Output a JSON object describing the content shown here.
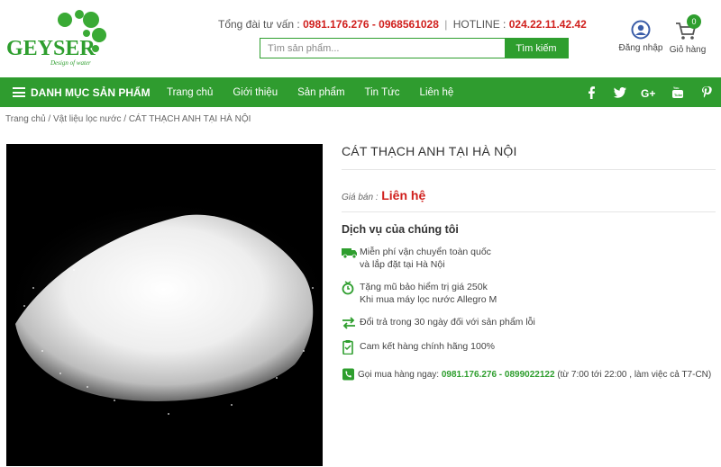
{
  "logo": {
    "text": "GEYSER",
    "tagline": "Design of water"
  },
  "header": {
    "consult_label": "Tổng đài tư vấn :",
    "consult_phone": "0981.176.276 - 0968561028",
    "separator": "|",
    "hotline_label": "HOTLINE :",
    "hotline_phone": "024.22.11.42.42",
    "search_placeholder": "Tìm sản phẩm...",
    "search_button": "Tìm kiếm",
    "login_label": "Đăng nhập",
    "cart_label": "Giỏ hàng",
    "cart_count": "0"
  },
  "nav": {
    "category_label": "DANH MỤC SẢN PHẨM",
    "links": [
      "Trang chủ",
      "Giới thiệu",
      "Sản phẩm",
      "Tin Tức",
      "Liên hệ"
    ],
    "socials": [
      "f",
      "t",
      "G+",
      "yt",
      "P"
    ]
  },
  "breadcrumb": "Trang chủ / Vật liệu lọc nước / CÁT THẠCH ANH TẠI HÀ NỘI",
  "product": {
    "title": "CÁT THẠCH ANH TẠI HÀ NỘI",
    "price_label": "Giá bán :",
    "price_value": "Liên hệ",
    "services_title": "Dịch vụ của chúng tôi",
    "services": [
      {
        "icon": "truck-icon",
        "line1": "Miễn phí vận chuyển toàn quốc",
        "line2": "và lắp đặt tại Hà Nội"
      },
      {
        "icon": "gift-icon",
        "line1": "Tặng mũ bảo hiểm trị giá 250k",
        "line2": "Khi mua máy lọc nước Allegro M"
      },
      {
        "icon": "exchange-icon",
        "line1": "Đổi trả trong 30 ngày đối với sản phẩm lỗi",
        "line2": ""
      },
      {
        "icon": "clipboard-icon",
        "line1": "Cam kết hàng chính hãng 100%",
        "line2": ""
      }
    ],
    "order_label": "Gọi mua hàng ngay:",
    "order_phone": "0981.176.276 - 0899022122",
    "order_hours": "(từ 7:00 tới 22:00 , làm việc cả T7-CN)"
  },
  "colors": {
    "green": "#2f9c2f",
    "red": "#d0201d"
  }
}
